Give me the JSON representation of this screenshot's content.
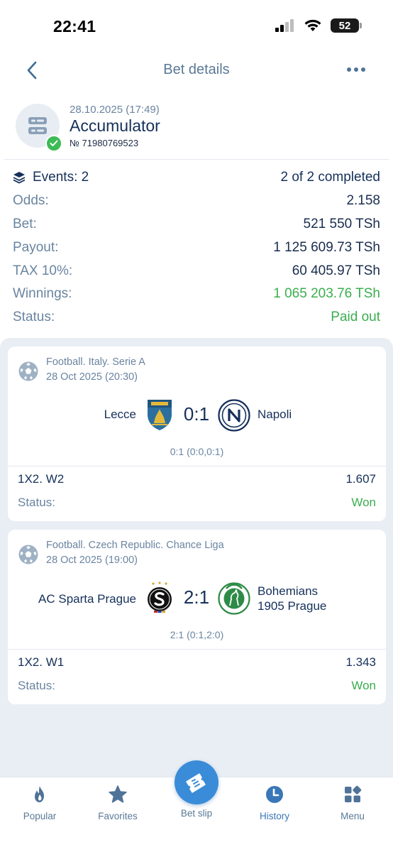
{
  "status_bar": {
    "time": "22:41",
    "battery": "52"
  },
  "header": {
    "title": "Bet details"
  },
  "bet": {
    "date": "28.10.2025 (17:49)",
    "type": "Accumulator",
    "number": "№ 71980769523"
  },
  "summary": {
    "events_label": "Events: 2",
    "events_value": "2 of 2 completed",
    "rows": [
      {
        "label": "Odds:",
        "value": "2.158"
      },
      {
        "label": "Bet:",
        "value": "521 550 TSh"
      },
      {
        "label": "Payout:",
        "value": "1 125 609.73 TSh"
      },
      {
        "label": "TAX 10%:",
        "value": "60 405.97 TSh"
      },
      {
        "label": "Winnings:",
        "value": "1 065 203.76 TSh"
      },
      {
        "label": "Status:",
        "value": "Paid out"
      }
    ]
  },
  "events": [
    {
      "league": "Football. Italy. Serie A",
      "date": "28 Oct 2025 (20:30)",
      "home": "Lecce",
      "away": "Napoli",
      "score": "0:1",
      "score_detail": "0:1 (0:0,0:1)",
      "market": "1X2. W2",
      "odd": "1.607",
      "status_label": "Status:",
      "status": "Won"
    },
    {
      "league": "Football. Czech Republic. Chance Liga",
      "date": "28 Oct 2025 (19:00)",
      "home": "AC Sparta Prague",
      "away_line1": "Bohemians",
      "away_line2": "1905 Prague",
      "score": "2:1",
      "score_detail": "2:1 (0:1,2:0)",
      "market": "1X2. W1",
      "odd": "1.343",
      "status_label": "Status:",
      "status": "Won"
    }
  ],
  "tabs": [
    {
      "label": "Popular",
      "icon": "flame-icon"
    },
    {
      "label": "Favorites",
      "icon": "star-icon"
    },
    {
      "label": "Bet slip",
      "icon": "ticket-icon"
    },
    {
      "label": "History",
      "icon": "clock-icon"
    },
    {
      "label": "Menu",
      "icon": "grid-icon"
    }
  ],
  "colors": {
    "accent": "#3a8cd8",
    "success": "#3aae4e",
    "text_primary": "#15305a",
    "text_secondary": "#6a84a0",
    "background_panel": "#e9eef4"
  }
}
